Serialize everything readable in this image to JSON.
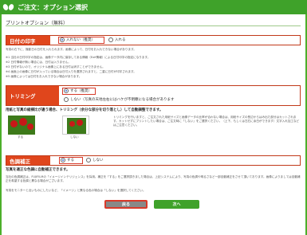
{
  "window": {
    "title": "ご注文：オプション選択"
  },
  "print_option": {
    "heading": "プリントオプション（無料）"
  },
  "date_print": {
    "label": "日付の印字",
    "option_on": "入れない（推奨）",
    "option_off": "入れる",
    "intro": "写真の右下に、撮影日の日付を入れられます。画像によって、日付をお入れできない場合があります。",
    "notes": [
      "※1 当社の日付印字の指定は、画像データ内に保存してある情報（Exif情報）による日付印字の指定になります。",
      "※2 日付情報が無い場合には、日付は入りません。",
      "※3 日付がないので、オリジナル画像上にある日付は消すことができません。",
      "※4 画面上の画像に日付が入っている場合は日付入りを選択されますと、二重に日付が印字されます。",
      "※5 画像によっては日付をお入れできない場合があります。"
    ]
  },
  "trimming": {
    "label": "トリミング",
    "option_on": "する（推奨）",
    "option_off": "しない（写真の天地左右にはハケが不明瞭になる場合があります",
    "intro": "用紙と写真の縦横比が違う場合、トリミング（余分な部分を切り落とし）して自動調整できます。",
    "desc": "トリミングを行いますと、ご注文された用紙サイズと画像データの比率が合わない場合は、用紙サイズの長辺からはみ出た部分はカットされます。カットせずにプリントしたい場合は、ご注文時に「しない」をご選択ください。（上下、もしくは左右に余白ができます）文字入れ加工などはご注意ください。",
    "thumb_yes": "する",
    "thumb_no": "しない"
  },
  "color_correction": {
    "label": "色調補正",
    "option_on": "する",
    "option_off": "しない",
    "intro": "写真を適正な色調に自動補正できます。",
    "desc": "当社の色調補正は、FUJIFILMの「イメージインテリジェンス」を採用。補正を「する」をご選択頂きました場合は、上記システムにより、写真の色調や明るさなど一部自動補正をさせて頂いております。画像によりましては自動補正を希望する色調と異なる場合がございます。",
    "note": "写真をモニターと近いものにしたいなど、「イメージ」と異なる色の場合は「しない」を選択してください。"
  },
  "actions": {
    "back": "戻る",
    "next": "次へ"
  },
  "colors": {
    "accent": "#e0461c",
    "brand": "#3fa22a"
  }
}
